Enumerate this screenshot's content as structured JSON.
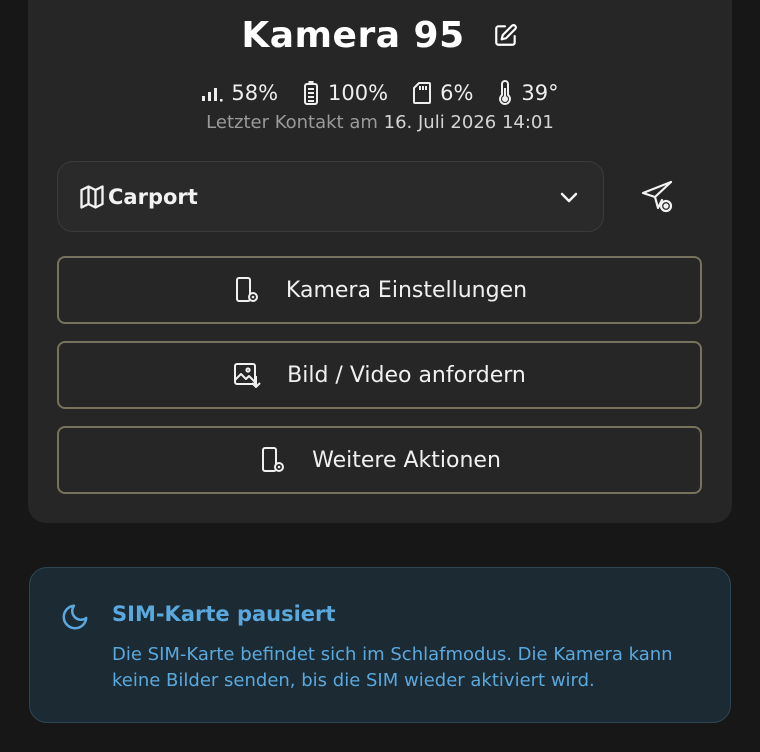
{
  "camera": {
    "title": "Kamera 95",
    "signal": "58%",
    "battery": "100%",
    "storage": "6%",
    "temperature": "39°"
  },
  "contact": {
    "prefix": "Letzter Kontakt am",
    "date": "16. Juli 2026 14:01"
  },
  "location": {
    "selected": "Carport"
  },
  "actions": {
    "settings_label": "Kamera Einstellungen",
    "request_label": "Bild / Video anfordern",
    "more_label": "Weitere Aktionen"
  },
  "notice": {
    "title": "SIM-Karte pausiert",
    "text": "Die SIM-Karte befindet sich im Schlafmodus. Die Kamera kann keine Bilder senden, bis die SIM wieder aktiviert wird."
  },
  "colors": {
    "accent_border": "#77725c",
    "notice_text": "#5aa9de",
    "notice_bg": "#1c2a33"
  },
  "icons": [
    "edit-icon",
    "signal-icon",
    "battery-icon",
    "sd-card-icon",
    "thermometer-icon",
    "map-icon",
    "chevron-down-icon",
    "location-pin-icon",
    "phone-settings-icon",
    "image-download-icon",
    "moon-icon"
  ]
}
